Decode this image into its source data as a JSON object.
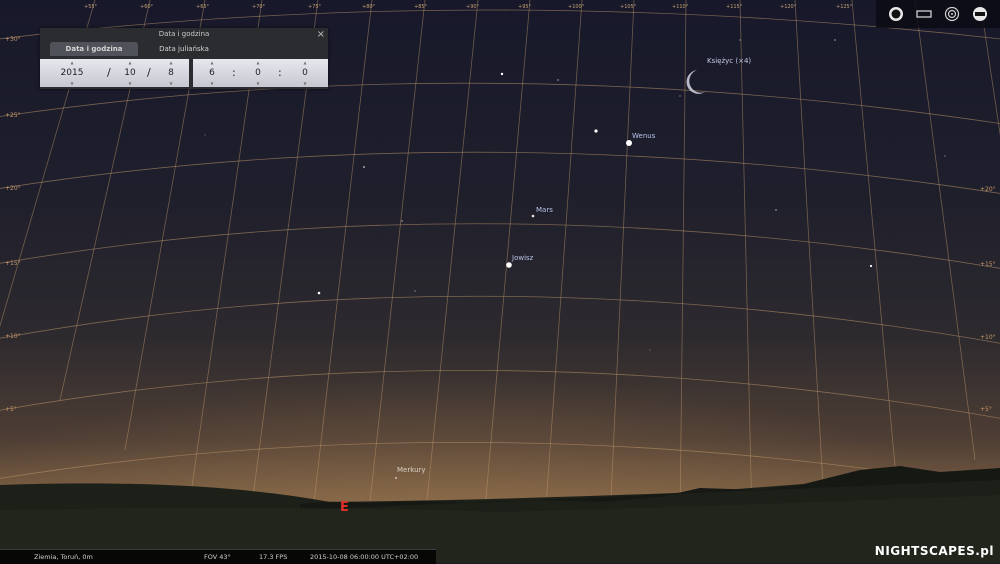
{
  "dialog": {
    "title": "Data i godzina",
    "close": "×",
    "tabs": [
      "Data i godzina",
      "Data juliańska"
    ],
    "year": "2015",
    "month": "10",
    "day": "8",
    "hour": "6",
    "minute": "0",
    "second": "0",
    "date_sep": "/",
    "time_sep": ":"
  },
  "objects": {
    "moon": "Księżyc (×4)",
    "venus": "Wenus",
    "mars": "Mars",
    "jupiter": "Jowisz",
    "mercury": "Merkury"
  },
  "cardinal": {
    "east": "E"
  },
  "grid": {
    "ra_labels": [
      "+55°",
      "+60°",
      "+65°",
      "+70°",
      "+75°",
      "+80°",
      "+85°",
      "+90°",
      "+95°",
      "+100°",
      "+105°",
      "+110°",
      "+115°",
      "+120°",
      "+125°",
      "+130°",
      "+135°"
    ],
    "dec_left": [
      "+30°",
      "+25°",
      "+20°",
      "+15°",
      "+10°",
      "+5°"
    ],
    "dec_right": [
      "+20°",
      "+15°",
      "+10°",
      "+5°"
    ]
  },
  "status_bar": {
    "location": "Ziemia, Toruń, 0m",
    "fov": "FOV 43°",
    "fps": "17.3 FPS",
    "datetime": "2015-10-08   06:00:00 UTC+02:00"
  },
  "watermark": "NIGHTSCAPES.pl",
  "toolbar_icons": [
    "moon-phase-icon",
    "screen-icon",
    "target-icon",
    "disc-icon"
  ],
  "colors": {
    "grid": "#c29a6e",
    "cardinal": "#e0302a",
    "planet_label": "#b9c4ea"
  }
}
